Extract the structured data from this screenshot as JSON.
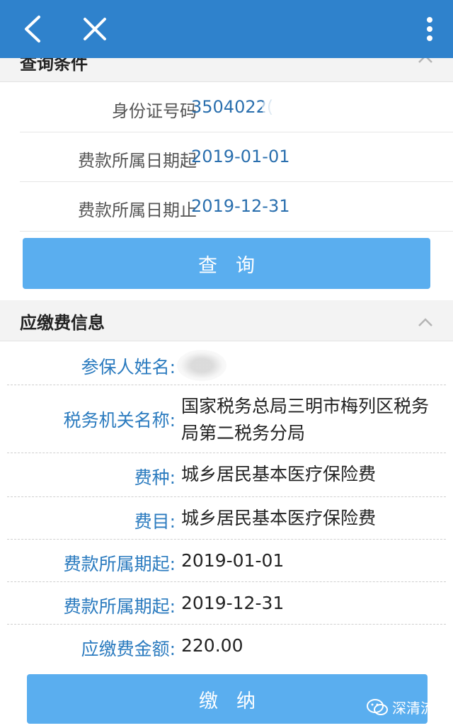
{
  "section_query": {
    "title": "查询条件",
    "rows": [
      {
        "label": "身份证号码",
        "value": "3504022("
      },
      {
        "label": "费款所属日期起",
        "value": "2019-01-01"
      },
      {
        "label": "费款所属日期止",
        "value": "2019-12-31"
      }
    ],
    "button_label": "查询"
  },
  "section_info": {
    "title": "应缴费信息",
    "rows": [
      {
        "label": "参保人姓名:",
        "value": ""
      },
      {
        "label": "税务机关名称:",
        "value": "国家税务总局三明市梅列区税务局第二税务分局"
      },
      {
        "label": "费种:",
        "value": "城乡居民基本医疗保险费"
      },
      {
        "label": "费目:",
        "value": "城乡居民基本医疗保险费"
      },
      {
        "label": "费款所属期起:",
        "value": "2019-01-01"
      },
      {
        "label": "费款所属期起:",
        "value": "2019-12-31"
      },
      {
        "label": "应缴费金额:",
        "value": "220.00"
      }
    ],
    "button_label": "缴纳"
  },
  "watermark": {
    "text": "深清流明"
  },
  "colors": {
    "topbar": "#2f82cc",
    "button": "#5aaeef",
    "label_blue": "#2b7bbf",
    "value_blue": "#2a6fae"
  }
}
